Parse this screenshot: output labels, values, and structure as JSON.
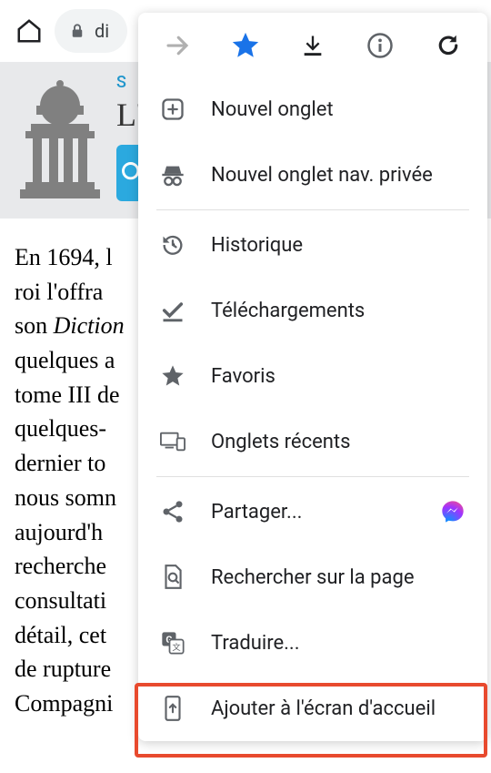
{
  "toolbar": {
    "url_text": "di"
  },
  "page": {
    "s_label": "S",
    "l_label": "L'A",
    "body_text": "En 1694, l roi l'offra son Diction quelques a tome III de quelques- dernier to nous somn aujourd'h recherche consultati détail, cet de rupture Compagni"
  },
  "menu": {
    "new_tab": "Nouvel onglet",
    "incognito": "Nouvel onglet nav. privée",
    "history": "Historique",
    "downloads": "Téléchargements",
    "bookmarks": "Favoris",
    "recent_tabs": "Onglets récents",
    "share": "Partager...",
    "find": "Rechercher sur la page",
    "translate": "Traduire...",
    "add_home": "Ajouter à l'écran d'accueil"
  }
}
